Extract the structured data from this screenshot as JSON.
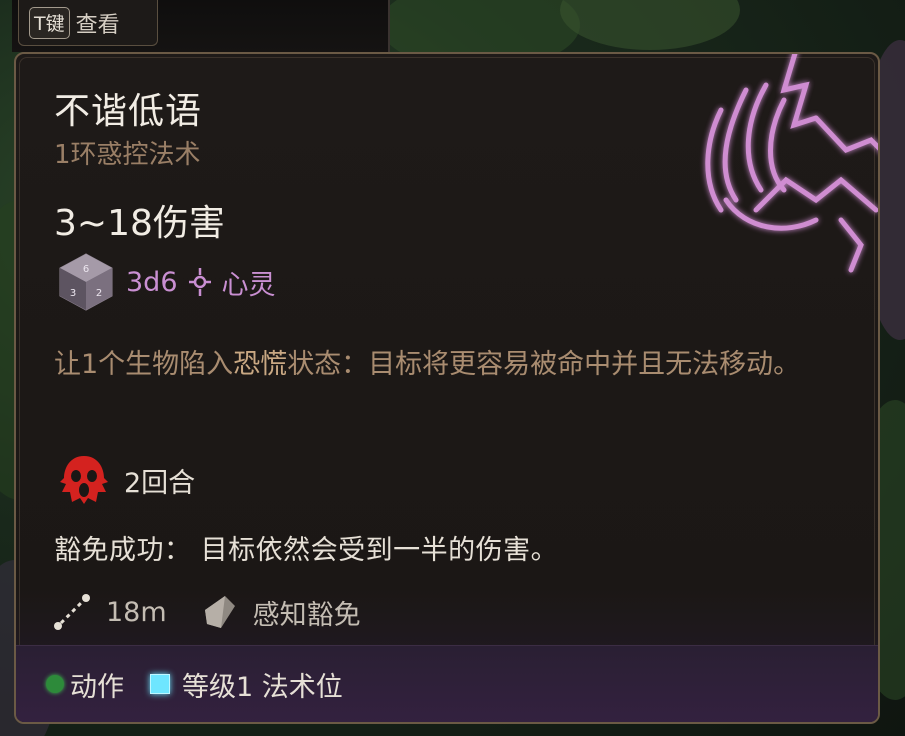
{
  "top_hint": {
    "key": "T键",
    "label": "查看"
  },
  "spell": {
    "name": "不谐低语",
    "subtitle": "1环惑控法术",
    "damage_range": "3~18伤害",
    "dice": "3d6",
    "damage_type": "心灵",
    "description_before": "让1个生物陷入",
    "description_keyword": "恐慌",
    "description_after": "状态：目标将更容易被命中并且无法移动。",
    "duration": "2回合",
    "save_success": "豁免成功： 目标依然会受到一半的伤害。",
    "range": "18m",
    "save_type": "感知豁免"
  },
  "footer": {
    "action": "动作",
    "slot": "等级1 法术位"
  },
  "colors": {
    "border": "#6b5a45",
    "psychic": "#c98fd2",
    "frightened": "#d4221f",
    "slot": "#6ee6ff",
    "action": "#2d8a3a"
  },
  "icons": [
    "dice-icon",
    "psychic-icon",
    "frightened-icon",
    "range-icon",
    "save-shield-icon",
    "action-dot-icon",
    "spell-slot-icon",
    "spell-art-icon"
  ]
}
